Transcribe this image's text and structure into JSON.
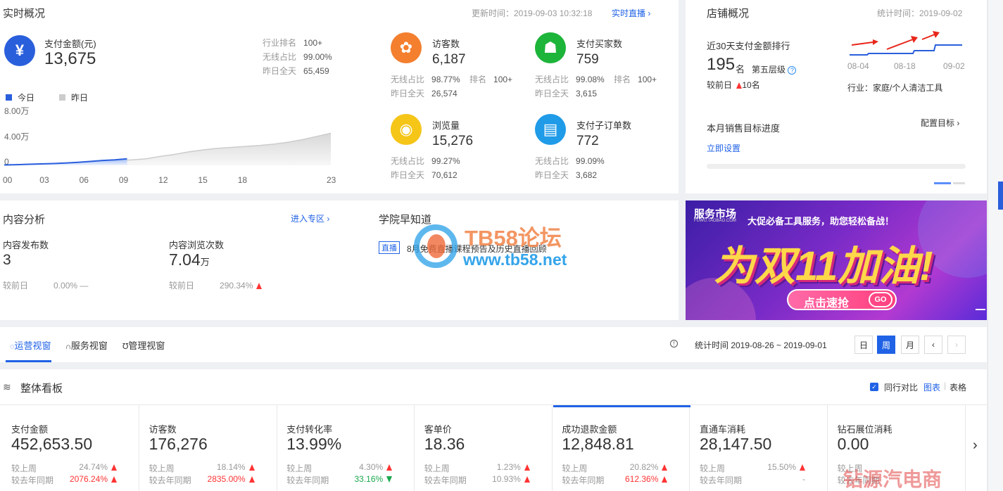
{
  "realtime": {
    "title": "实时概况",
    "updated": "更新时间：2019-09-03 10:32:18",
    "live_link": "实时直播",
    "pay_amount_label": "支付金额(元)",
    "pay_amount_value": "13,675",
    "side_stats": [
      {
        "label": "行业排名",
        "value": "100+"
      },
      {
        "label": "无线占比",
        "value": "99.00%"
      },
      {
        "label": "昨日全天",
        "value": "65,459"
      }
    ],
    "legend_today": "今日",
    "legend_yesterday": "昨日",
    "metrics": [
      {
        "label": "访客数",
        "value": "6,187",
        "l1": "无线占比",
        "v1": "98.77%",
        "rank_label": "排名",
        "rank_value": "100+",
        "l2": "昨日全天",
        "v2": "26,574",
        "color": "#f47f2f"
      },
      {
        "label": "支付买家数",
        "value": "759",
        "l1": "无线占比",
        "v1": "99.08%",
        "rank_label": "排名",
        "rank_value": "100+",
        "l2": "昨日全天",
        "v2": "3,615",
        "color": "#1db43a"
      },
      {
        "label": "浏览量",
        "value": "15,276",
        "l1": "无线占比",
        "v1": "99.27%",
        "l2": "昨日全天",
        "v2": "70,612",
        "color": "#f5c518"
      },
      {
        "label": "支付子订单数",
        "value": "772",
        "l1": "无线占比",
        "v1": "99.09%",
        "l2": "昨日全天",
        "v2": "3,682",
        "color": "#1f9be8"
      }
    ]
  },
  "chart_data": {
    "type": "area",
    "x": [
      0,
      1,
      2,
      3,
      4,
      5,
      6,
      7,
      8,
      9,
      10,
      11,
      12,
      13,
      14,
      15,
      16,
      17,
      18,
      19,
      20,
      21,
      22,
      23
    ],
    "x_ticks": [
      "00",
      "03",
      "06",
      "09",
      "12",
      "15",
      "18",
      "23"
    ],
    "y_ticks": [
      "8.00万",
      "4.00万",
      "0"
    ],
    "ylim": [
      0,
      80000
    ],
    "series": [
      {
        "name": "今日",
        "color": "#2a5fdc",
        "values": [
          500,
          1000,
          1600,
          2200,
          2800,
          3600,
          4700,
          6000,
          7500,
          8500,
          10200
        ]
      },
      {
        "name": "昨日",
        "color": "#cccccc",
        "values": [
          500,
          1000,
          1600,
          2200,
          2800,
          3600,
          4700,
          6000,
          7500,
          8500,
          10200,
          14000,
          17000,
          21000,
          24000,
          26500,
          28000,
          29500,
          31000,
          33000,
          36000,
          40000,
          45000,
          50000
        ]
      }
    ]
  },
  "shop": {
    "title": "店铺概况",
    "stat_time": "统计时间：2019-09-02",
    "rank_label": "近30天支付金额排行",
    "rank_value": "195",
    "rank_unit": "名",
    "tier": "第五层级",
    "compare_label": "较前日",
    "compare_value": "10名",
    "dates": [
      "08-04",
      "08-18",
      "09-02"
    ],
    "industry": "行业：家庭/个人清洁工具",
    "target_label": "本月销售目标进度",
    "configure": "配置目标",
    "set_now": "立即设置"
  },
  "content": {
    "title": "内容分析",
    "enter": "进入专区",
    "publish_label": "内容发布数",
    "publish_value": "3",
    "views_label": "内容浏览次数",
    "views_value": "7.04",
    "views_unit": "万",
    "cmp1_label": "较前日",
    "cmp1_value": "0.00%",
    "cmp1_dash": "—",
    "cmp2_label": "较前日",
    "cmp2_value": "290.34%"
  },
  "academy": {
    "title": "学院早知道",
    "tag": "直播",
    "news": "8月免费直播课程预告及历史直播回顾"
  },
  "watermark": {
    "brand": "TB58论坛",
    "url": "www.tb58.net"
  },
  "banner": {
    "logo": "服务市场",
    "logo_sub": "FUWU.TAOBAO.COM",
    "headline": "大促必备工具服务，助您轻松备战！",
    "slogan": "为双11加油!",
    "button": "点击速抢",
    "go": "GO"
  },
  "tabs": {
    "items": [
      "运营视窗",
      "服务视窗",
      "管理视窗"
    ],
    "stat_range": "统计时间 2019-08-26 ~ 2019-09-01",
    "day": "日",
    "week": "周",
    "month": "月"
  },
  "board": {
    "title": "整体看板",
    "peer_compare": "同行对比",
    "chart_link": "图表",
    "table_link": "表格",
    "kpis": [
      {
        "label": "支付金额",
        "value": "452,653.50",
        "r1l": "较上周",
        "r1v": "24.74%",
        "r1d": "up",
        "r2l": "较去年同期",
        "r2v": "2076.24%",
        "r2d": "up",
        "r2c": "red"
      },
      {
        "label": "访客数",
        "value": "176,276",
        "r1l": "较上周",
        "r1v": "18.14%",
        "r1d": "up",
        "r2l": "较去年同期",
        "r2v": "2835.00%",
        "r2d": "up",
        "r2c": "red"
      },
      {
        "label": "支付转化率",
        "value": "13.99%",
        "r1l": "较上周",
        "r1v": "4.30%",
        "r1d": "up",
        "r2l": "较去年同期",
        "r2v": "33.16%",
        "r2d": "down",
        "r2c": "green"
      },
      {
        "label": "客单价",
        "value": "18.36",
        "r1l": "较上周",
        "r1v": "1.23%",
        "r1d": "up",
        "r2l": "较去年同期",
        "r2v": "10.93%",
        "r2d": "up",
        "r2c": "gray"
      },
      {
        "label": "成功退款金额",
        "value": "12,848.81",
        "r1l": "较上周",
        "r1v": "20.82%",
        "r1d": "up",
        "r2l": "较去年同期",
        "r2v": "612.36%",
        "r2d": "up",
        "r2c": "red"
      },
      {
        "label": "直通车消耗",
        "value": "28,147.50",
        "r1l": "较上周",
        "r1v": "15.50%",
        "r1d": "up",
        "r2l": "较去年同期",
        "r2v": "-",
        "r2d": "none",
        "r2c": "gray"
      },
      {
        "label": "钻石展位消耗",
        "value": "0.00",
        "r1l": "较上周",
        "r1v": "",
        "r1d": "none",
        "r2l": "较去年同期",
        "r2v": "",
        "r2d": "none",
        "r2c": "gray"
      }
    ],
    "corner_stamp": "钻源汽电商"
  }
}
